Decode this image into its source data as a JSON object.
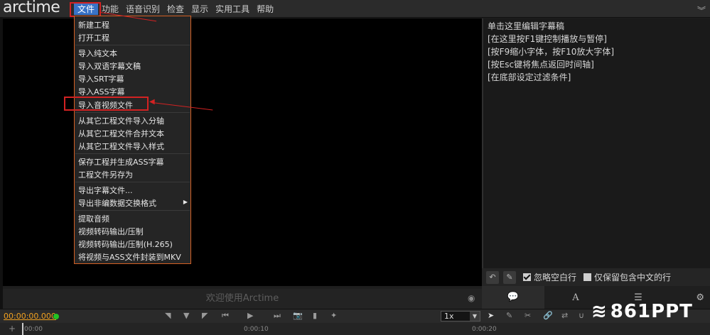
{
  "app": {
    "logo": "arctime"
  },
  "menubar": {
    "items": [
      "文件",
      "功能",
      "语音识别",
      "检查",
      "显示",
      "实用工具",
      "帮助"
    ],
    "active": "文件"
  },
  "file_menu": {
    "items": [
      "新建工程",
      "打开工程",
      "导入纯文本",
      "导入双语字幕文稿",
      "导入SRT字幕",
      "导入ASS字幕",
      "导入音视频文件",
      "从其它工程文件导入分轴",
      "从其它工程文件合并文本",
      "从其它工程文件导入样式",
      "保存工程并生成ASS字幕",
      "工程文件另存为",
      "导出字幕文件...",
      "导出非编数据交换格式",
      "提取音频",
      "视频转码输出/压制",
      "视频转码输出/压制(H.265)",
      "将视频与ASS文件封装到MKV"
    ],
    "highlighted": "导入音视频文件",
    "has_submenu": "导出非编数据交换格式"
  },
  "video": {
    "welcome": "欢迎使用Arctime"
  },
  "subtitle_editor": {
    "hints": [
      "单击这里编辑字幕稿",
      "[在这里按F1键控制播放与暂停]",
      "[按F9缩小字体，按F10放大字体]",
      "[按Esc键将焦点返回时间轴]",
      "[在底部设定过滤条件]"
    ],
    "ignore_blank_label": "忽略空白行",
    "ignore_blank_checked": true,
    "chinese_only_label": "仅保留包含中文的行",
    "chinese_only_checked": false,
    "tab_text_label": "A"
  },
  "transport": {
    "timecode": "00:00:00.000",
    "speed": "1x",
    "status_color": "#22c322"
  },
  "timeline": {
    "ticks": [
      "00:00",
      "0:00:10",
      "0:00:20"
    ]
  },
  "watermark": "861PPT",
  "colors": {
    "accent_orange": "#d35f24",
    "annotation_red": "#d32222",
    "menu_active": "#3a73c6"
  }
}
